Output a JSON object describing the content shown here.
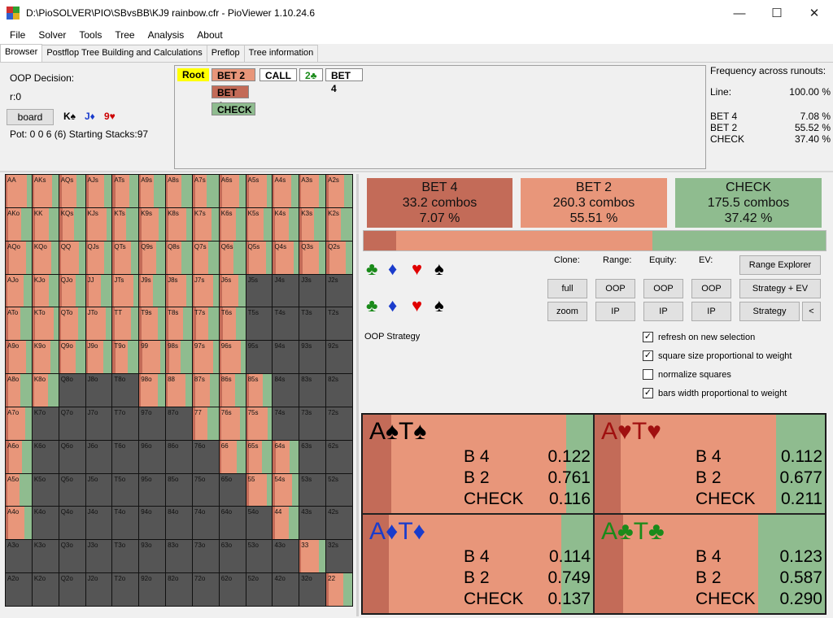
{
  "window": {
    "title": "D:\\PioSOLVER\\PIO\\SBvsBB\\KJ9 rainbow.cfr - PioViewer 1.10.24.6",
    "minimize": "—",
    "maximize": "☐",
    "close": "✕"
  },
  "menu": [
    "File",
    "Solver",
    "Tools",
    "Tree",
    "Analysis",
    "About"
  ],
  "tabs": [
    "Browser",
    "Postflop Tree Building and Calculations",
    "Preflop",
    "Tree information"
  ],
  "info": {
    "decision": "OOP Decision:",
    "r": "r:0",
    "board_button": "board",
    "board_cards": [
      {
        "text": "K♠",
        "color": "#000000"
      },
      {
        "text": "J♦",
        "color": "#1a3ccc"
      },
      {
        "text": "9♥",
        "color": "#cc0000"
      }
    ],
    "pot": "Pot: 0 0 6 (6) Starting Stacks:97"
  },
  "tree": {
    "root": "Root",
    "bet2": "BET 2",
    "call": "CALL",
    "card": "2♣",
    "bet4_right": "BET 4",
    "bet4": "BET 4",
    "check": "CHECK"
  },
  "frequency": {
    "title": "Frequency across runouts:",
    "line_label": "Line:",
    "line_value": "100.00 %",
    "rows": [
      {
        "label": "BET 4",
        "value": "7.08 %"
      },
      {
        "label": "BET 2",
        "value": "55.52 %"
      },
      {
        "label": "CHECK",
        "value": "37.40 %"
      }
    ]
  },
  "colors": {
    "bet4": "#c36b58",
    "bet2": "#e8967a",
    "check": "#8fbc8f",
    "empty": "#555555",
    "root": "#ffff00"
  },
  "actions": [
    {
      "name": "BET 4",
      "combos": "33.2 combos",
      "pct": "7.07 %"
    },
    {
      "name": "BET 2",
      "combos": "260.3 combos",
      "pct": "55.51 %"
    },
    {
      "name": "CHECK",
      "combos": "175.5 combos",
      "pct": "37.42 %"
    }
  ],
  "strategy_bar": {
    "bet4": 0.0707,
    "bet2": 0.5551,
    "check": 0.3742
  },
  "controls": {
    "clone": "Clone:",
    "range": "Range:",
    "equity": "Equity:",
    "ev": "EV:",
    "full": "full",
    "zoom": "zoom",
    "oop": "OOP",
    "ip": "IP",
    "range_explorer": "Range Explorer",
    "strategy_ev": "Strategy + EV",
    "strategy": "Strategy",
    "back": "<",
    "oop_strategy": "OOP Strategy"
  },
  "suit_rows": [
    [
      {
        "g": "♣",
        "c": "#1a8a1a"
      },
      {
        "g": "♦",
        "c": "#1a3ccc"
      },
      {
        "g": "♥",
        "c": "#e00000"
      },
      {
        "g": "♠",
        "c": "#000000"
      }
    ],
    [
      {
        "g": "♣",
        "c": "#1a8a1a"
      },
      {
        "g": "♦",
        "c": "#1a3ccc"
      },
      {
        "g": "♥",
        "c": "#e00000"
      },
      {
        "g": "♠",
        "c": "#000000"
      }
    ]
  ],
  "checkboxes": [
    {
      "label": "refresh on new selection",
      "checked": true
    },
    {
      "label": "square size proportional to weight",
      "checked": true
    },
    {
      "label": "normalize squares",
      "checked": false
    },
    {
      "label": "bars width proportional to weight",
      "checked": true
    }
  ],
  "grid": [
    [
      "AA",
      "AKs",
      "AQs",
      "AJs",
      "ATs",
      "A9s",
      "A8s",
      "A7s",
      "A6s",
      "A5s",
      "A4s",
      "A3s",
      "A2s"
    ],
    [
      "AKo",
      "KK",
      "KQs",
      "KJs",
      "KTs",
      "K9s",
      "K8s",
      "K7s",
      "K6s",
      "K5s",
      "K4s",
      "K3s",
      "K2s"
    ],
    [
      "AQo",
      "KQo",
      "QQ",
      "QJs",
      "QTs",
      "Q9s",
      "Q8s",
      "Q7s",
      "Q6s",
      "Q5s",
      "Q4s",
      "Q3s",
      "Q2s"
    ],
    [
      "AJo",
      "KJo",
      "QJo",
      "JJ",
      "JTs",
      "J9s",
      "J8s",
      "J7s",
      "J6s",
      "J5s",
      "J4s",
      "J3s",
      "J2s"
    ],
    [
      "ATo",
      "KTo",
      "QTo",
      "JTo",
      "TT",
      "T9s",
      "T8s",
      "T7s",
      "T6s",
      "T5s",
      "T4s",
      "T3s",
      "T2s"
    ],
    [
      "A9o",
      "K9o",
      "Q9o",
      "J9o",
      "T9o",
      "99",
      "98s",
      "97s",
      "96s",
      "95s",
      "94s",
      "93s",
      "92s"
    ],
    [
      "A8o",
      "K8o",
      "Q8o",
      "J8o",
      "T8o",
      "98o",
      "88",
      "87s",
      "86s",
      "85s",
      "84s",
      "83s",
      "82s"
    ],
    [
      "A7o",
      "K7o",
      "Q7o",
      "J7o",
      "T7o",
      "97o",
      "87o",
      "77",
      "76s",
      "75s",
      "74s",
      "73s",
      "72s"
    ],
    [
      "A6o",
      "K6o",
      "Q6o",
      "J6o",
      "T6o",
      "96o",
      "86o",
      "76o",
      "66",
      "65s",
      "64s",
      "63s",
      "62s"
    ],
    [
      "A5o",
      "K5o",
      "Q5o",
      "J5o",
      "T5o",
      "95o",
      "85o",
      "75o",
      "65o",
      "55",
      "54s",
      "53s",
      "52s"
    ],
    [
      "A4o",
      "K4o",
      "Q4o",
      "J4o",
      "T4o",
      "94o",
      "84o",
      "74o",
      "64o",
      "54o",
      "44",
      "43s",
      "42s"
    ],
    [
      "A3o",
      "K3o",
      "Q3o",
      "J3o",
      "T3o",
      "93o",
      "83o",
      "73o",
      "63o",
      "53o",
      "43o",
      "33",
      "32s"
    ],
    [
      "A2o",
      "K2o",
      "Q2o",
      "J2o",
      "T2o",
      "92o",
      "82o",
      "72o",
      "62o",
      "52o",
      "42o",
      "32o",
      "22"
    ]
  ],
  "grid_in_range": [
    [
      1,
      1,
      1,
      1,
      1,
      1,
      1,
      1,
      1,
      1,
      1,
      1,
      1
    ],
    [
      1,
      1,
      1,
      1,
      1,
      1,
      1,
      1,
      1,
      1,
      1,
      1,
      1
    ],
    [
      1,
      1,
      1,
      1,
      1,
      1,
      1,
      1,
      1,
      1,
      1,
      1,
      1
    ],
    [
      1,
      1,
      1,
      1,
      1,
      1,
      1,
      1,
      1,
      0,
      0,
      0,
      0
    ],
    [
      1,
      1,
      1,
      1,
      1,
      1,
      1,
      1,
      1,
      0,
      0,
      0,
      0
    ],
    [
      1,
      1,
      1,
      1,
      1,
      1,
      1,
      1,
      1,
      0,
      0,
      0,
      0
    ],
    [
      1,
      1,
      0,
      0,
      0,
      1,
      1,
      1,
      1,
      1,
      0,
      0,
      0
    ],
    [
      1,
      0,
      0,
      0,
      0,
      0,
      0,
      1,
      1,
      1,
      0,
      0,
      0
    ],
    [
      1,
      0,
      0,
      0,
      0,
      0,
      0,
      0,
      1,
      1,
      1,
      0,
      0
    ],
    [
      1,
      0,
      0,
      0,
      0,
      0,
      0,
      0,
      0,
      1,
      1,
      0,
      0
    ],
    [
      1,
      0,
      0,
      0,
      0,
      0,
      0,
      0,
      0,
      0,
      1,
      0,
      0
    ],
    [
      0,
      0,
      0,
      0,
      0,
      0,
      0,
      0,
      0,
      0,
      0,
      1,
      0
    ],
    [
      0,
      0,
      0,
      0,
      0,
      0,
      0,
      0,
      0,
      0,
      0,
      0,
      1
    ]
  ],
  "combos": [
    {
      "card1": "A",
      "suit": "♠",
      "card2": "T",
      "color": "#000000",
      "b4": "0.122",
      "b2": "0.761",
      "check": "0.116",
      "w4": 0.122,
      "w2": 0.761
    },
    {
      "card1": "A",
      "suit": "♥",
      "card2": "T",
      "color": "#a01010",
      "b4": "0.112",
      "b2": "0.677",
      "check": "0.211",
      "w4": 0.112,
      "w2": 0.677
    },
    {
      "card1": "A",
      "suit": "♦",
      "card2": "T",
      "color": "#1a3ccc",
      "b4": "0.114",
      "b2": "0.749",
      "check": "0.137",
      "w4": 0.114,
      "w2": 0.749
    },
    {
      "card1": "A",
      "suit": "♣",
      "card2": "T",
      "color": "#1a8a1a",
      "b4": "0.123",
      "b2": "0.587",
      "check": "0.290",
      "w4": 0.123,
      "w2": 0.587
    }
  ],
  "combo_labels": {
    "b4": "B 4",
    "b2": "B 2",
    "check": "CHECK"
  }
}
